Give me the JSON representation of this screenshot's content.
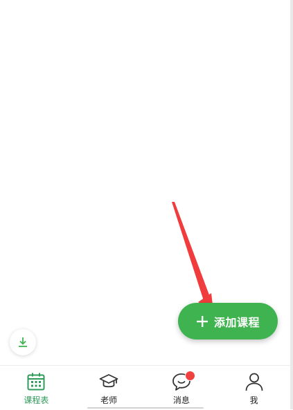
{
  "fab": {
    "label": "添加课程",
    "icon": "plus-icon",
    "color": "#3fb34f"
  },
  "download": {
    "icon": "download-icon",
    "color": "#3fb34f"
  },
  "tabs": [
    {
      "label": "课程表",
      "icon": "calendar-icon",
      "active": true
    },
    {
      "label": "老师",
      "icon": "graduation-cap-icon",
      "active": false
    },
    {
      "label": "消息",
      "icon": "chat-bubble-icon",
      "active": false,
      "badge": true
    },
    {
      "label": "我",
      "icon": "person-icon",
      "active": false
    }
  ],
  "colors": {
    "accent": "#2f9a59",
    "badge": "#f04141",
    "annotation": "#f03c3c"
  }
}
